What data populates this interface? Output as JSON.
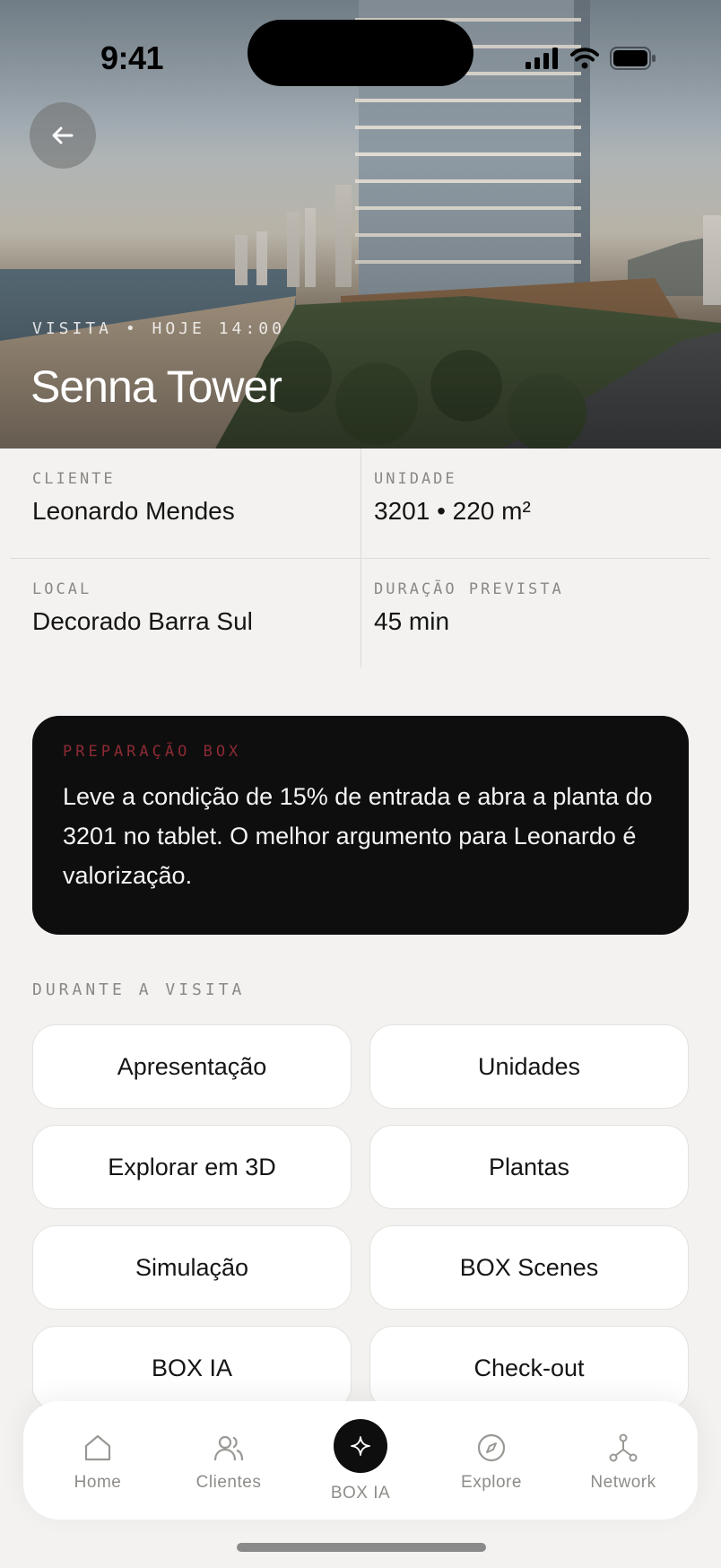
{
  "status_bar": {
    "time": "9:41"
  },
  "hero": {
    "eyebrow": "VISITA • HOJE 14:00",
    "title": "Senna Tower"
  },
  "info": [
    {
      "label": "CLIENTE",
      "value": "Leonardo Mendes"
    },
    {
      "label": "UNIDADE",
      "value": "3201 • 220 m²"
    },
    {
      "label": "LOCAL",
      "value": "Decorado Barra Sul"
    },
    {
      "label": "DURAÇÃO PREVISTA",
      "value": "45 min"
    }
  ],
  "prep": {
    "label": "PREPARAÇÃO BOX",
    "text": "Leve a condição de 15% de entrada e abra a planta do 3201 no tablet. O melhor argumento para Leonardo é valorização."
  },
  "section": {
    "label": "DURANTE A VISITA"
  },
  "actions": [
    "Apresentação",
    "Unidades",
    "Explorar em 3D",
    "Plantas",
    "Simulação",
    "BOX Scenes",
    "BOX IA",
    "Check-out"
  ],
  "tabbar": [
    {
      "label": "Home",
      "icon": "home-icon"
    },
    {
      "label": "Clientes",
      "icon": "users-icon"
    },
    {
      "label": "BOX IA",
      "icon": "sparkle-icon"
    },
    {
      "label": "Explore",
      "icon": "compass-icon"
    },
    {
      "label": "Network",
      "icon": "network-icon"
    }
  ],
  "colors": {
    "background": "#f3f2f0",
    "card_dark": "#0e0e0e",
    "prep_accent": "#8c2a34",
    "muted_text": "#8a8884"
  }
}
